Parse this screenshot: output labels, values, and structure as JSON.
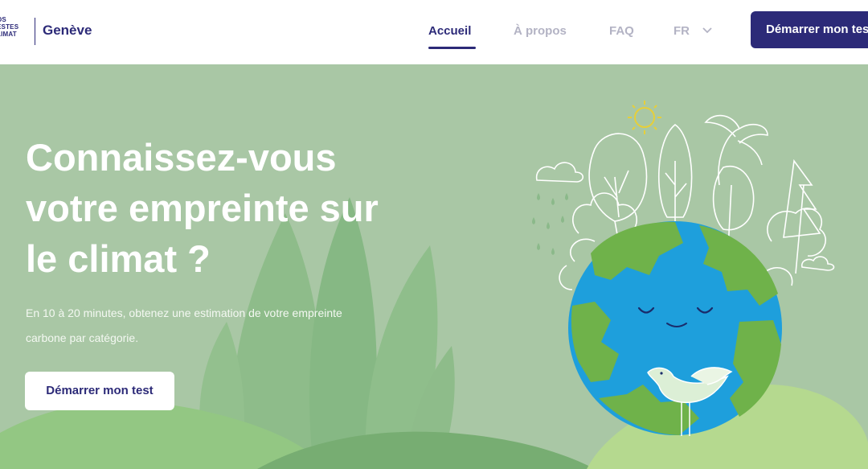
{
  "header": {
    "logo_lines": [
      "OS",
      "ESTES",
      "LIMAT"
    ],
    "city": "Genève",
    "nav": [
      {
        "label": "Accueil",
        "active": true
      },
      {
        "label": "À propos",
        "active": false
      },
      {
        "label": "FAQ",
        "active": false
      }
    ],
    "language": "FR",
    "cta_label": "Démarrer mon test"
  },
  "hero": {
    "title_lines": [
      "Connaissez-vous",
      "votre empreinte sur",
      "le climat ?"
    ],
    "subtitle_lines": [
      "En 10 à 20 minutes, obtenez une estimation de votre empreinte",
      "carbone par catégorie."
    ],
    "cta_label": "Démarrer mon test"
  },
  "colors": {
    "brand": "#2c2a78",
    "hero_bg": "#a9c7a5",
    "earth_ocean": "#1e9fdc",
    "earth_land": "#6fb24a"
  },
  "icons": [
    "chevron-down-icon",
    "sun-icon",
    "cloud-icon",
    "rain-icon",
    "earth-illustration",
    "bird-illustration",
    "plants-illustration"
  ]
}
